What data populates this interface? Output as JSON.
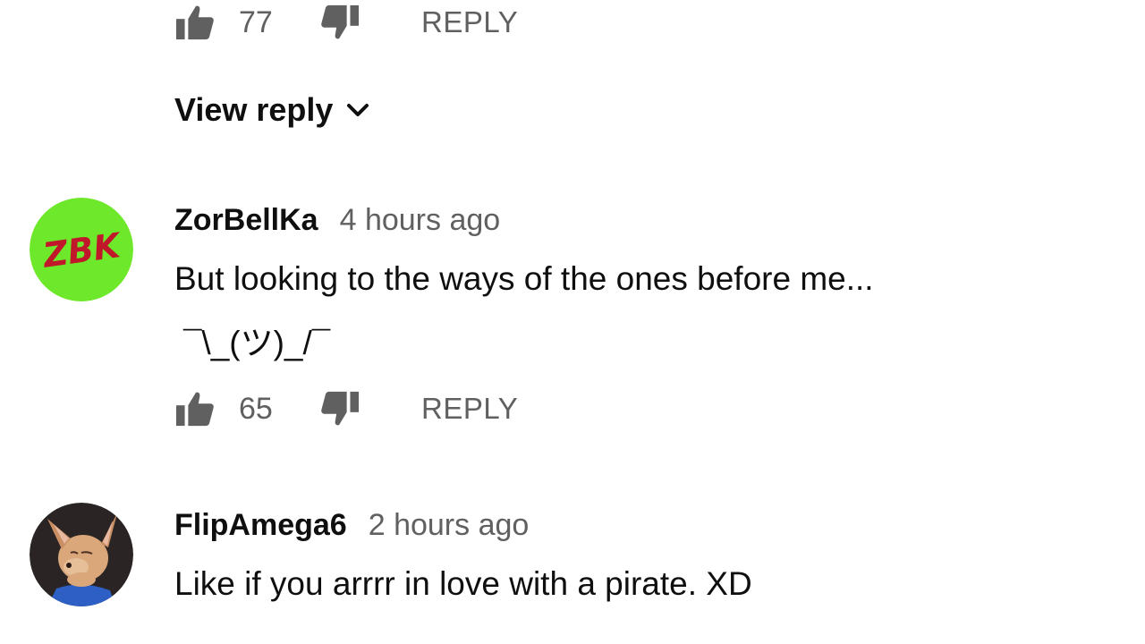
{
  "reply_label": "REPLY",
  "top_actions": {
    "likes": "77"
  },
  "view_reply": {
    "label": "View reply"
  },
  "comments": [
    {
      "author": "ZorBellKa",
      "time": "4 hours ago",
      "lines": [
        "But looking to the ways of the ones before me...",
        "¯\\_(ツ)_/¯"
      ],
      "likes": "65",
      "avatar": {
        "text": "ZBK",
        "bg": "#6ee82a",
        "fg": "#c0182a"
      }
    },
    {
      "author": "FlipAmega6",
      "time": "2 hours ago",
      "lines": [
        "Like if you arrrr in love with a pirate. XD"
      ]
    }
  ],
  "colors": {
    "secondary_text": "#606060",
    "primary_text": "#0f0f0f",
    "background": "#ffffff"
  },
  "icons": [
    "thumb-up-icon",
    "thumb-down-icon",
    "chevron-down-icon"
  ]
}
